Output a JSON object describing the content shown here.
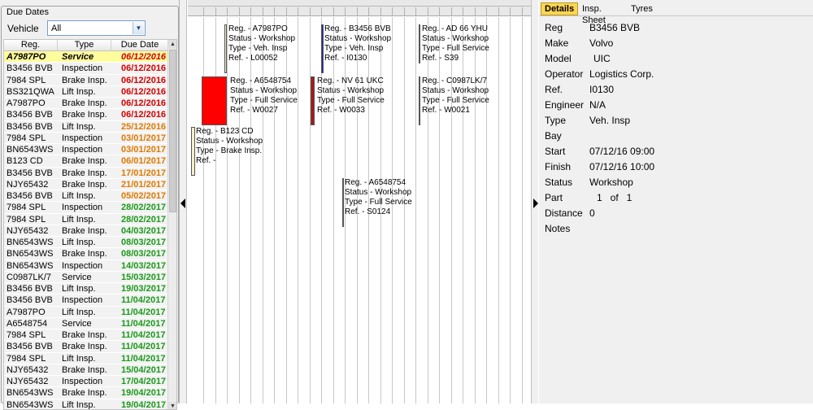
{
  "left": {
    "legend": "Due Dates",
    "vehicle_label": "Vehicle",
    "vehicle_value": "All",
    "columns": {
      "reg": "Reg.",
      "type": "Type",
      "date": "Due Date"
    },
    "rows": [
      {
        "reg": "A7987PO",
        "type": "Service",
        "date": "06/12/2016",
        "color": "#d40000",
        "selected": true
      },
      {
        "reg": "B3456 BVB",
        "type": "Inspection",
        "date": "06/12/2016",
        "color": "#d40000"
      },
      {
        "reg": "7984 SPL",
        "type": "Brake Insp.",
        "date": "06/12/2016",
        "color": "#d40000"
      },
      {
        "reg": "BS321QWA",
        "type": "Lift Insp.",
        "date": "06/12/2016",
        "color": "#d40000"
      },
      {
        "reg": "A7987PO",
        "type": "Brake Insp.",
        "date": "06/12/2016",
        "color": "#d40000"
      },
      {
        "reg": "B3456 BVB",
        "type": "Brake Insp.",
        "date": "06/12/2016",
        "color": "#d40000"
      },
      {
        "reg": "B3456 BVB",
        "type": "Lift Insp.",
        "date": "25/12/2016",
        "color": "#e07a00"
      },
      {
        "reg": "7984 SPL",
        "type": "Inspection",
        "date": "03/01/2017",
        "color": "#e07a00"
      },
      {
        "reg": "BN6543WS",
        "type": "Inspection",
        "date": "03/01/2017",
        "color": "#e07a00"
      },
      {
        "reg": "B123 CD",
        "type": "Brake Insp.",
        "date": "06/01/2017",
        "color": "#e07a00"
      },
      {
        "reg": "B3456 BVB",
        "type": "Brake Insp.",
        "date": "17/01/2017",
        "color": "#e07a00"
      },
      {
        "reg": "NJY65432",
        "type": "Brake Insp.",
        "date": "21/01/2017",
        "color": "#e07a00"
      },
      {
        "reg": "B3456 BVB",
        "type": "Lift Insp.",
        "date": "05/02/2017",
        "color": "#e07a00"
      },
      {
        "reg": "7984 SPL",
        "type": "Inspection",
        "date": "28/02/2017",
        "color": "#1a9a1a"
      },
      {
        "reg": "7984 SPL",
        "type": "Lift Insp.",
        "date": "28/02/2017",
        "color": "#1a9a1a"
      },
      {
        "reg": "NJY65432",
        "type": "Brake Insp.",
        "date": "04/03/2017",
        "color": "#1a9a1a"
      },
      {
        "reg": "BN6543WS",
        "type": "Lift Insp.",
        "date": "08/03/2017",
        "color": "#1a9a1a"
      },
      {
        "reg": "BN6543WS",
        "type": "Brake Insp.",
        "date": "08/03/2017",
        "color": "#1a9a1a"
      },
      {
        "reg": "BN6543WS",
        "type": "Inspection",
        "date": "14/03/2017",
        "color": "#1a9a1a"
      },
      {
        "reg": "C0987LK/7",
        "type": "Service",
        "date": "15/03/2017",
        "color": "#1a9a1a"
      },
      {
        "reg": "B3456 BVB",
        "type": "Lift Insp.",
        "date": "19/03/2017",
        "color": "#1a9a1a"
      },
      {
        "reg": "B3456 BVB",
        "type": "Inspection",
        "date": "11/04/2017",
        "color": "#1a9a1a"
      },
      {
        "reg": "A7987PO",
        "type": "Lift Insp.",
        "date": "11/04/2017",
        "color": "#1a9a1a"
      },
      {
        "reg": "A6548754",
        "type": "Service",
        "date": "11/04/2017",
        "color": "#1a9a1a"
      },
      {
        "reg": "7984 SPL",
        "type": "Brake Insp.",
        "date": "11/04/2017",
        "color": "#1a9a1a"
      },
      {
        "reg": "B3456 BVB",
        "type": "Brake Insp.",
        "date": "11/04/2017",
        "color": "#1a9a1a"
      },
      {
        "reg": "7984 SPL",
        "type": "Lift Insp.",
        "date": "11/04/2017",
        "color": "#1a9a1a"
      },
      {
        "reg": "NJY65432",
        "type": "Brake Insp.",
        "date": "15/04/2017",
        "color": "#1a9a1a"
      },
      {
        "reg": "NJY65432",
        "type": "Inspection",
        "date": "17/04/2017",
        "color": "#1a9a1a"
      },
      {
        "reg": "BN6543WS",
        "type": "Brake Insp.",
        "date": "19/04/2017",
        "color": "#1a9a1a"
      },
      {
        "reg": "BN6543WS",
        "type": "Lift Insp.",
        "date": "19/04/2017",
        "color": "#1a9a1a"
      }
    ]
  },
  "schedule": {
    "bookings": [
      {
        "lines": [
          "Reg. - A7987PO",
          "Status - Workshop",
          "Type - Veh. Insp",
          "Ref. - L00052"
        ],
        "color": "#f6f0c8"
      },
      {
        "lines": [
          "Reg. - B3456 BVB",
          "Status - Workshop",
          "Type - Veh. Insp",
          "Ref. - I0130"
        ],
        "color": "#2020c0"
      },
      {
        "lines": [
          "Reg. - AD 66 YHU",
          "Status - Workshop",
          "Type - Full Service",
          "Ref. - S39"
        ],
        "color": "#4a4a4a"
      },
      {
        "lines": [
          "Reg. - A6548754",
          "Status - Workshop",
          "Type - Full Service",
          "Ref. - W0027"
        ],
        "color": "#ff0000"
      },
      {
        "lines": [
          "Reg. - NV 61 UKC",
          "Status - Workshop",
          "Type - Full Service",
          "Ref. - W0033"
        ],
        "color": "#a81818"
      },
      {
        "lines": [
          "Reg. - C0987LK/7",
          "Status - Workshop",
          "Type - Full Service",
          "Ref. - W0021"
        ],
        "color": "#4a4a4a"
      },
      {
        "lines": [
          "Reg. - B123 CD",
          "Status - Workshop",
          "Type - Brake Insp.",
          "Ref. -"
        ],
        "color": "#f6f0c8"
      },
      {
        "lines": [
          "Reg. - A6548754",
          "Status - Workshop",
          "Type - Full Service",
          "Ref. - S0124"
        ],
        "color": "#4a4a4a"
      }
    ]
  },
  "right": {
    "tabs": [
      "Details",
      "Insp. Sheet",
      "Tyres"
    ],
    "details": [
      {
        "label": "Reg",
        "value": "B3456 BVB"
      },
      {
        "label": "Make",
        "value": "Volvo"
      },
      {
        "label": "Model",
        "value": "UIC"
      },
      {
        "label": "Operator",
        "value": "Logistics Corp."
      },
      {
        "label": "Ref.",
        "value": "I0130"
      },
      {
        "label": "Engineer",
        "value": "N/A"
      },
      {
        "label": "Type",
        "value": "Veh. Insp"
      },
      {
        "label": "Bay",
        "value": ""
      },
      {
        "label": "Start",
        "value": "07/12/16 09:00"
      },
      {
        "label": "Finish",
        "value": "07/12/16 10:00"
      },
      {
        "label": "Status",
        "value": "Workshop"
      },
      {
        "label": "Part",
        "value": "1   of   1"
      },
      {
        "label": "Distance",
        "value": "0"
      },
      {
        "label": "Notes",
        "value": ""
      }
    ]
  }
}
